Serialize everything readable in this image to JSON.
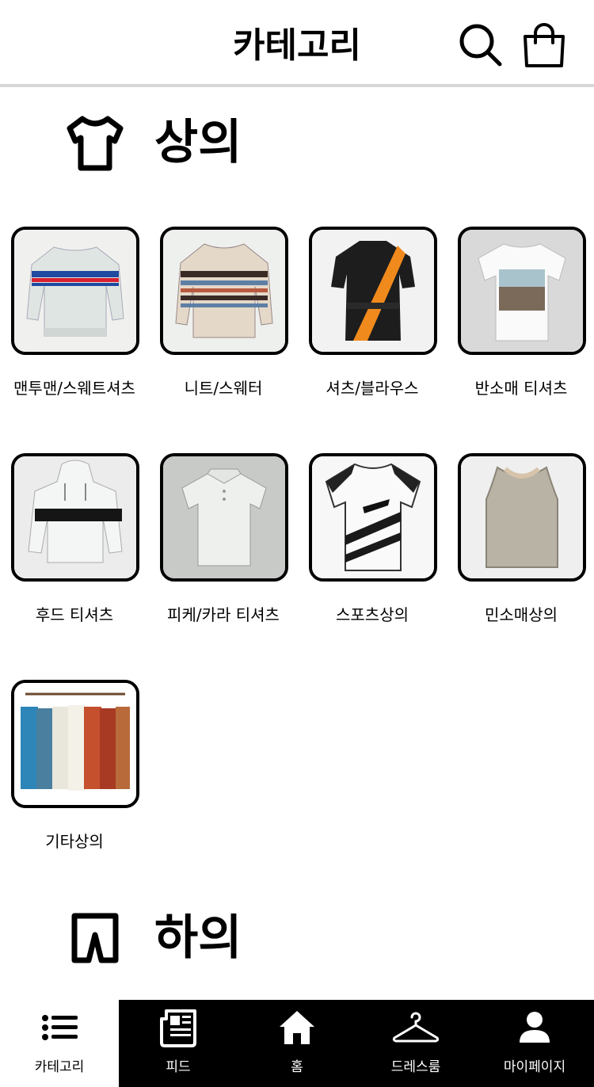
{
  "header": {
    "title": "카테고리"
  },
  "sections": [
    {
      "title": "상의",
      "items": [
        {
          "label": "맨투맨/스웨트셔츠"
        },
        {
          "label": "니트/스웨터"
        },
        {
          "label": "셔츠/블라우스"
        },
        {
          "label": "반소매 티셔츠"
        },
        {
          "label": "후드 티셔츠"
        },
        {
          "label": "피케/카라 티셔츠"
        },
        {
          "label": "스포츠상의"
        },
        {
          "label": "민소매상의"
        },
        {
          "label": "기타상의"
        }
      ]
    },
    {
      "title": "하의"
    }
  ],
  "bottom_nav": {
    "active": "카테고리",
    "items": [
      {
        "label": "카테고리",
        "icon": "list-icon"
      },
      {
        "label": "피드",
        "icon": "newspaper-icon"
      },
      {
        "label": "홈",
        "icon": "home-icon"
      },
      {
        "label": "드레스룸",
        "icon": "hanger-icon"
      },
      {
        "label": "마이페이지",
        "icon": "person-icon"
      }
    ]
  },
  "colors": {
    "background": "#ffffff",
    "nav_background": "#000000",
    "divider": "#d8d8d8"
  }
}
